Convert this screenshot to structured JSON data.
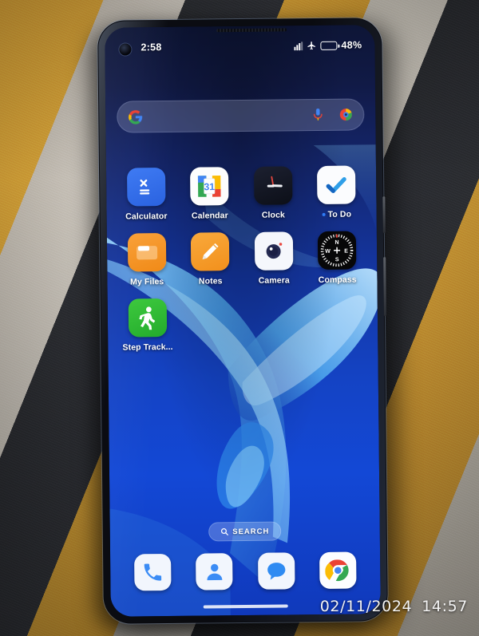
{
  "photo": {
    "watermark_date": "02/11/2024",
    "watermark_time": "14:57"
  },
  "phone": {
    "status_bar": {
      "clock": "2:58",
      "battery_percent": "48%",
      "battery_level": 48,
      "icons": [
        "signal-icon",
        "airplane-mode-icon",
        "battery-icon"
      ]
    },
    "search_widget": {
      "provider_icon": "google-g-icon",
      "mic_icon": "microphone-icon",
      "lens_icon": "google-lens-icon"
    },
    "app_rows": [
      [
        {
          "label": "Calculator",
          "icon": "calculator-icon",
          "badge": false
        },
        {
          "label": "Calendar",
          "icon": "calendar-icon",
          "date_number": "31",
          "badge": false
        },
        {
          "label": "Clock",
          "icon": "clock-icon",
          "badge": false
        },
        {
          "label": "To Do",
          "icon": "todo-icon",
          "badge": true
        }
      ],
      [
        {
          "label": "My Files",
          "icon": "folder-icon",
          "badge": false
        },
        {
          "label": "Notes",
          "icon": "pencil-icon",
          "badge": false
        },
        {
          "label": "Camera",
          "icon": "camera-icon",
          "badge": false
        },
        {
          "label": "Compass",
          "icon": "compass-icon",
          "badge": false
        }
      ],
      [
        {
          "label": "Step Track...",
          "icon": "walking-person-icon",
          "badge": false
        }
      ]
    ],
    "compass_points": {
      "north": "N",
      "west": "W",
      "east": "E",
      "south": "S"
    },
    "search_pill": {
      "label": "SEARCH",
      "icon": "magnifier-icon"
    },
    "dock": [
      {
        "label": "Phone",
        "icon": "phone-handset-icon"
      },
      {
        "label": "Contacts",
        "icon": "person-icon"
      },
      {
        "label": "Messages",
        "icon": "speech-bubble-icon"
      },
      {
        "label": "Chrome",
        "icon": "chrome-icon"
      }
    ]
  },
  "colors": {
    "wallpaper_top": "#0d1536",
    "wallpaper_bottom": "#1348d6",
    "battery_fill": "#ffbe1a",
    "accent_blue": "#2f7cf6",
    "icon_orange": "#f9a13a",
    "icon_green": "#3ec93e"
  }
}
